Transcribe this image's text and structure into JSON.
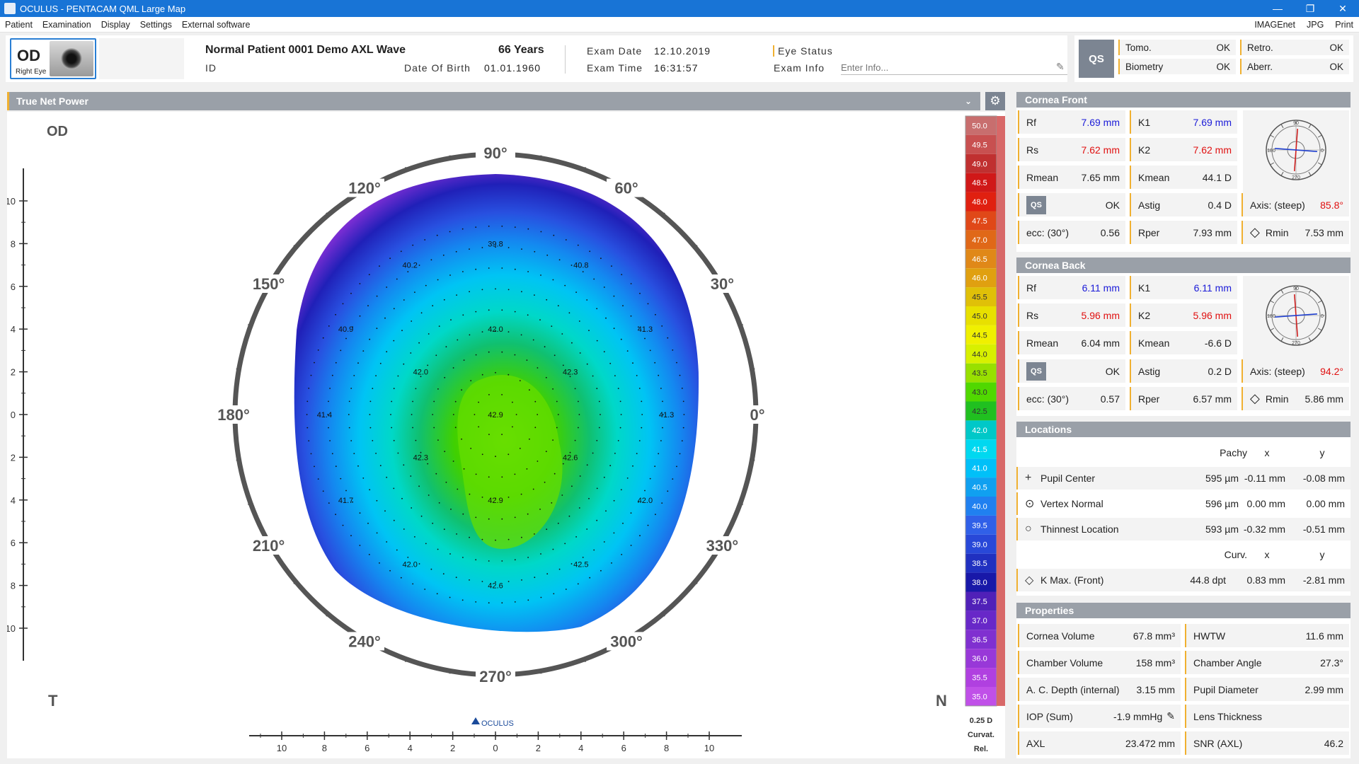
{
  "window": {
    "title": "OCULUS  -  PENTACAM  QML Large Map",
    "min": "—",
    "restore": "❐",
    "close": "✕"
  },
  "menu": {
    "items": [
      "Patient",
      "Examination",
      "Display",
      "Settings",
      "External software"
    ],
    "right_items": [
      "IMAGEnet",
      "JPG",
      "Print"
    ]
  },
  "patient": {
    "eye_code": "OD",
    "eye_label": "Right Eye",
    "name": "Normal Patient 0001 Demo AXL Wave",
    "id_label": "ID",
    "age": "66 Years",
    "dob_label": "Date Of Birth",
    "dob": "01.01.1960",
    "exam_date_label": "Exam Date",
    "exam_date": "12.10.2019",
    "exam_time_label": "Exam Time",
    "exam_time": "16:31:57",
    "eye_status_label": "Eye Status",
    "exam_info_label": "Exam Info",
    "exam_info_placeholder": "Enter Info..."
  },
  "qs_panel": {
    "label": "QS",
    "items": [
      {
        "label": "Tomo.",
        "value": "OK"
      },
      {
        "label": "Retro.",
        "value": "OK"
      },
      {
        "label": "Biometry",
        "value": "OK"
      },
      {
        "label": "Aberr.",
        "value": "OK"
      }
    ]
  },
  "map": {
    "title": "True Net Power",
    "eye": "OD",
    "temporal": "T",
    "nasal": "N",
    "logo": "OCULUS",
    "angle_labels": [
      {
        "deg": 90,
        "text": "90°"
      },
      {
        "deg": 60,
        "text": "60°"
      },
      {
        "deg": 30,
        "text": "30°"
      },
      {
        "deg": 0,
        "text": "0°"
      },
      {
        "deg": 330,
        "text": "330°"
      },
      {
        "deg": 300,
        "text": "300°"
      },
      {
        "deg": 270,
        "text": "270°"
      },
      {
        "deg": 240,
        "text": "240°"
      },
      {
        "deg": 210,
        "text": "210°"
      },
      {
        "deg": 180,
        "text": "180°"
      },
      {
        "deg": 150,
        "text": "150°"
      },
      {
        "deg": 120,
        "text": "120°"
      }
    ],
    "vertical_ticks": [
      "10",
      "8",
      "6",
      "4",
      "2",
      "0",
      "2",
      "4",
      "6",
      "8",
      "10"
    ],
    "horizontal_ticks": [
      "10",
      "8",
      "6",
      "4",
      "2",
      "0",
      "2",
      "4",
      "6",
      "8",
      "10"
    ],
    "values": [
      {
        "x": 0,
        "y": 8.0,
        "v": "39.8"
      },
      {
        "x": -4,
        "y": 7.0,
        "v": "40.2"
      },
      {
        "x": 4,
        "y": 7.0,
        "v": "40.8"
      },
      {
        "x": -7,
        "y": 4.0,
        "v": "40.9"
      },
      {
        "x": 0,
        "y": 4.0,
        "v": "42.0"
      },
      {
        "x": 7,
        "y": 4.0,
        "v": "41.3"
      },
      {
        "x": -3.5,
        "y": 2.0,
        "v": "42.0"
      },
      {
        "x": 3.5,
        "y": 2.0,
        "v": "42.3"
      },
      {
        "x": -8,
        "y": 0,
        "v": "41.4"
      },
      {
        "x": 0,
        "y": 0,
        "v": "42.9"
      },
      {
        "x": 8,
        "y": 0,
        "v": "41.3"
      },
      {
        "x": -3.5,
        "y": -2.0,
        "v": "42.3"
      },
      {
        "x": 3.5,
        "y": -2.0,
        "v": "42.6"
      },
      {
        "x": -7,
        "y": -4.0,
        "v": "41.7"
      },
      {
        "x": 0,
        "y": -4.0,
        "v": "42.9"
      },
      {
        "x": 7,
        "y": -4.0,
        "v": "42.0"
      },
      {
        "x": -4,
        "y": -7.0,
        "v": "42.0"
      },
      {
        "x": 4,
        "y": -7.0,
        "v": "42.5"
      },
      {
        "x": 0,
        "y": -8.0,
        "v": "42.6"
      }
    ]
  },
  "color_scale": {
    "values": [
      "50.0",
      "49.5",
      "49.0",
      "48.5",
      "48.0",
      "47.5",
      "47.0",
      "46.5",
      "46.0",
      "45.5",
      "45.0",
      "44.5",
      "44.0",
      "43.5",
      "43.0",
      "42.5",
      "42.0",
      "41.5",
      "41.0",
      "40.5",
      "40.0",
      "39.5",
      "39.0",
      "38.5",
      "38.0",
      "37.5",
      "37.0",
      "36.5",
      "36.0",
      "35.5",
      "35.0"
    ],
    "colors": [
      "#c86e6e",
      "#c85050",
      "#c03030",
      "#d01818",
      "#e02010",
      "#e04818",
      "#e06818",
      "#e08818",
      "#e0a010",
      "#e0c008",
      "#e8e000",
      "#f0f000",
      "#d8f000",
      "#98e000",
      "#50d800",
      "#20c020",
      "#00c8c8",
      "#00d8f0",
      "#00c0f8",
      "#10a0f0",
      "#2080f0",
      "#3060e8",
      "#2848d8",
      "#2030c0",
      "#1818a8",
      "#5020b8",
      "#6828c8",
      "#8030d0",
      "#9838d8",
      "#b040e0",
      "#c050e8"
    ],
    "step": "0.25 D",
    "mode": "Curvat.",
    "ref": "Rel."
  },
  "cornea_front": {
    "title": "Cornea Front",
    "rf": {
      "label": "Rf",
      "value": "7.69 mm"
    },
    "k1": {
      "label": "K1",
      "value": "7.69 mm"
    },
    "rs": {
      "label": "Rs",
      "value": "7.62 mm"
    },
    "k2": {
      "label": "K2",
      "value": "7.62 mm"
    },
    "rmean": {
      "label": "Rmean",
      "value": "7.65 mm"
    },
    "kmean": {
      "label": "Kmean",
      "value": "44.1 D"
    },
    "qs": {
      "label": "QS",
      "value": "OK"
    },
    "astig": {
      "label": "Astig",
      "value": "0.4 D"
    },
    "axis": {
      "label": "Axis: (steep)",
      "value": "85.8°"
    },
    "ecc": {
      "label": "ecc: (30°)",
      "value": "0.56"
    },
    "rper": {
      "label": "Rper",
      "value": "7.93 mm"
    },
    "rmin": {
      "label": "Rmin",
      "value": "7.53 mm"
    },
    "axis_deg": 85.8
  },
  "cornea_back": {
    "title": "Cornea Back",
    "rf": {
      "label": "Rf",
      "value": "6.11 mm"
    },
    "k1": {
      "label": "K1",
      "value": "6.11 mm"
    },
    "rs": {
      "label": "Rs",
      "value": "5.96 mm"
    },
    "k2": {
      "label": "K2",
      "value": "5.96 mm"
    },
    "rmean": {
      "label": "Rmean",
      "value": "6.04 mm"
    },
    "kmean": {
      "label": "Kmean",
      "value": "-6.6 D"
    },
    "qs": {
      "label": "QS",
      "value": "OK"
    },
    "astig": {
      "label": "Astig",
      "value": "0.2 D"
    },
    "axis": {
      "label": "Axis: (steep)",
      "value": "94.2°"
    },
    "ecc": {
      "label": "ecc: (30°)",
      "value": "0.57"
    },
    "rper": {
      "label": "Rper",
      "value": "6.57 mm"
    },
    "rmin": {
      "label": "Rmin",
      "value": "5.86 mm"
    },
    "axis_deg": 94.2
  },
  "dial_labels": {
    "top": "90",
    "left": "180",
    "right": "0",
    "bottom": "270"
  },
  "locations": {
    "title": "Locations",
    "head1": [
      "Pachy",
      "x",
      "y"
    ],
    "head2": [
      "Curv.",
      "x",
      "y"
    ],
    "rows": [
      {
        "name": "Pupil Center",
        "pachy": "595 µm",
        "x": "-0.11 mm",
        "y": "-0.08 mm"
      },
      {
        "name": "Vertex Normal",
        "pachy": "596 µm",
        "x": "0.00 mm",
        "y": "0.00 mm"
      },
      {
        "name": "Thinnest Location",
        "pachy": "593 µm",
        "x": "-0.32 mm",
        "y": "-0.51 mm"
      }
    ],
    "kmax": {
      "name": "K Max. (Front)",
      "curv": "44.8 dpt",
      "x": "0.83 mm",
      "y": "-2.81 mm"
    }
  },
  "properties": {
    "title": "Properties",
    "left": [
      {
        "label": "Cornea Volume",
        "value": "67.8 mm³"
      },
      {
        "label": "Chamber Volume",
        "value": "158 mm³"
      },
      {
        "label": "A. C. Depth (internal)",
        "value": "3.15 mm"
      },
      {
        "label": "IOP (Sum)",
        "value": "-1.9 mmHg"
      },
      {
        "label": "AXL",
        "value": "23.472 mm"
      }
    ],
    "right": [
      {
        "label": "HWTW",
        "value": "11.6 mm"
      },
      {
        "label": "Chamber Angle",
        "value": "27.3°"
      },
      {
        "label": "Pupil Diameter",
        "value": "2.99 mm"
      },
      {
        "label": "Lens Thickness",
        "value": ""
      },
      {
        "label": "SNR (AXL)",
        "value": "46.2"
      }
    ]
  }
}
